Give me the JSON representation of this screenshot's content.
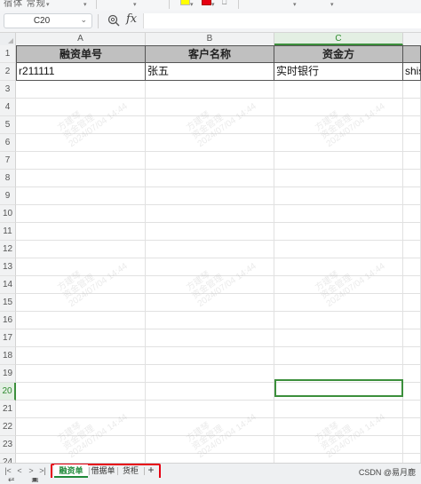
{
  "colors": {
    "accent_green": "#3c8f3c",
    "header_fill": "#c0c0c0",
    "highlight_red": "#e60012",
    "ribbon_yellow": "#ffff00",
    "ribbon_red": "#e60012"
  },
  "ribbon": {
    "left_text": "宿体 常规",
    "icons": [
      "fill-color-icon",
      "font-color-icon",
      "format-icon",
      "chevron-down-icon"
    ]
  },
  "formula_bar": {
    "name_box": "C20",
    "fx_label": "fx",
    "formula_value": ""
  },
  "grid": {
    "columns": [
      {
        "id": "A",
        "label": "A"
      },
      {
        "id": "B",
        "label": "B"
      },
      {
        "id": "C",
        "label": "C",
        "active": true
      }
    ],
    "rows": [
      "1",
      "2",
      "3",
      "4",
      "5",
      "6",
      "7",
      "8",
      "9",
      "10",
      "11",
      "12",
      "13",
      "14",
      "15",
      "16",
      "17",
      "18",
      "19",
      "20",
      "21",
      "22",
      "23",
      "24"
    ],
    "active_row": "20",
    "active_cell": "C20",
    "header_row": [
      "融资单号",
      "客户名称",
      "资金方",
      ""
    ],
    "data_row": [
      "r211111",
      "张五",
      "实时银行",
      "shisi"
    ],
    "watermark_lines": [
      "方建琴",
      "资金管理",
      "2024/07/04 14:44"
    ]
  },
  "sheet_tabs": {
    "nav_icons": [
      "first-sheet-icon",
      "prev-sheet-icon",
      "next-sheet-icon",
      "last-sheet-icon"
    ],
    "nav_glyphs": [
      "|<",
      "<",
      ">",
      ">|"
    ],
    "tabs": [
      {
        "label": "融资单",
        "active": true
      },
      {
        "label": "借据单",
        "active": false
      },
      {
        "label": "货柜",
        "active": false
      }
    ],
    "add_label": "+",
    "credit": "CSDN @易月鹿"
  },
  "status": {
    "icons": [
      "sheet-settings-icon",
      "page-view-icon"
    ]
  }
}
